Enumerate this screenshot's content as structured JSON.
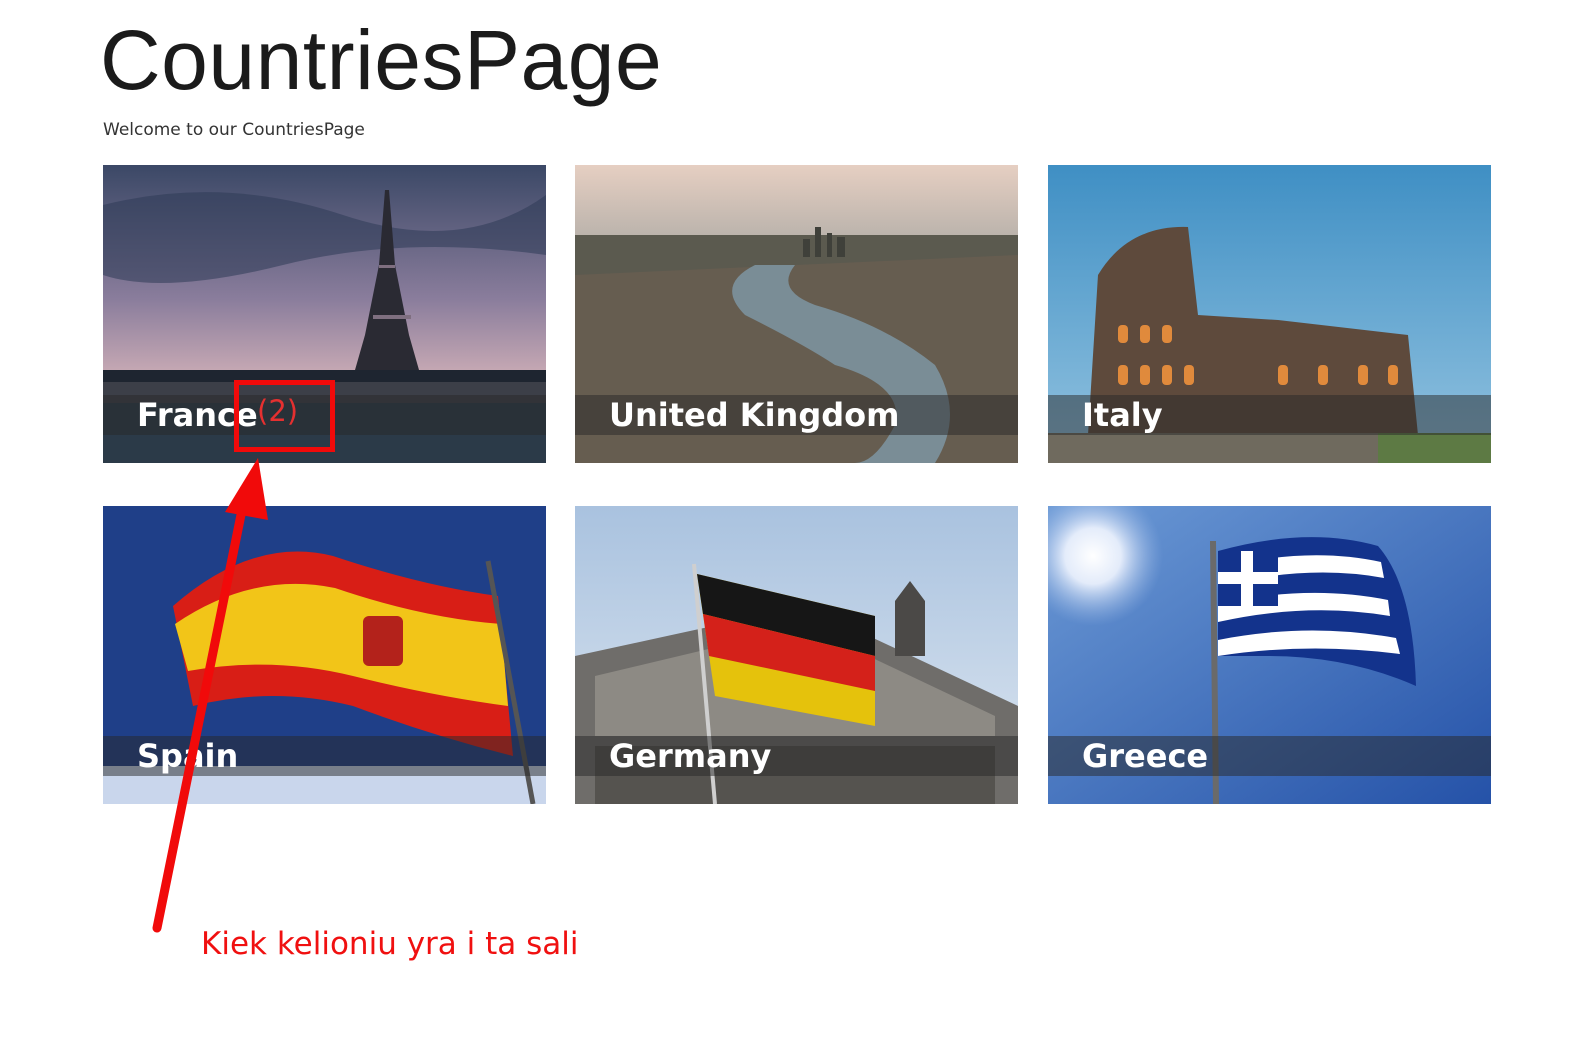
{
  "page": {
    "title": "CountriesPage",
    "welcome": "Welcome to our CountriesPage"
  },
  "countries": [
    {
      "name": "France",
      "count": "(2)",
      "scene": "eiffel-tower-at-dusk"
    },
    {
      "name": "United Kingdom",
      "scene": "aerial-london-thames"
    },
    {
      "name": "Italy",
      "scene": "colosseum-evening"
    },
    {
      "name": "Spain",
      "scene": "spanish-flag"
    },
    {
      "name": "Germany",
      "scene": "german-flag-reichstag"
    },
    {
      "name": "Greece",
      "scene": "greek-flag-sunny-sky"
    }
  ],
  "annotation": {
    "text": "Kiek kelioniu yra i ta sali",
    "color": "#f10a0a"
  },
  "colors": {
    "caption_text": "#ffffff",
    "caption_bar": "rgba(40,40,40,0.5)",
    "annotation": "#f10a0a"
  }
}
